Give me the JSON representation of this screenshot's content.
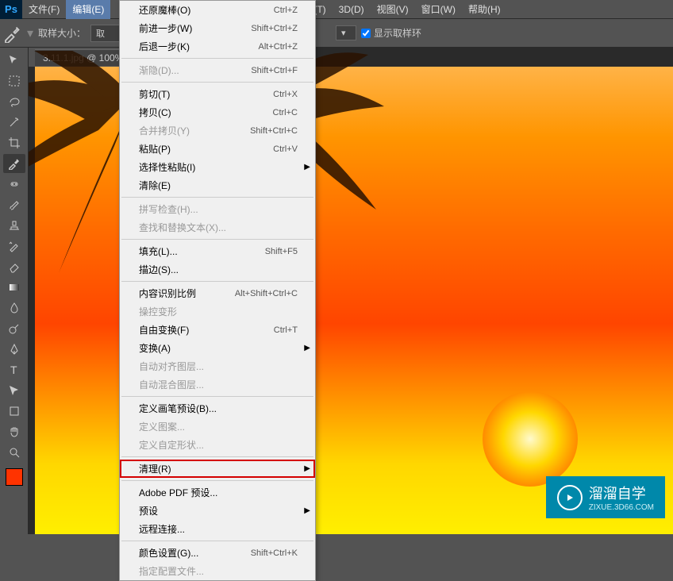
{
  "app": {
    "logo": "Ps"
  },
  "menubar": {
    "items": [
      "文件(F)",
      "编辑(E)",
      "",
      "",
      "(T)",
      "3D(D)",
      "视图(V)",
      "窗口(W)",
      "帮助(H)"
    ],
    "active_index": 1
  },
  "optionsbar": {
    "sample_size_label": "取样大小：",
    "sample_size_value": "取",
    "show_ring_label": "显示取样环"
  },
  "tab": {
    "title": "3.11.1.jpg @ 100%"
  },
  "dropdown": {
    "items": [
      {
        "label": "还原魔棒(O)",
        "shortcut": "Ctrl+Z"
      },
      {
        "label": "前进一步(W)",
        "shortcut": "Shift+Ctrl+Z"
      },
      {
        "label": "后退一步(K)",
        "shortcut": "Alt+Ctrl+Z"
      },
      {
        "sep": true
      },
      {
        "label": "渐隐(D)...",
        "shortcut": "Shift+Ctrl+F",
        "disabled": true
      },
      {
        "sep": true
      },
      {
        "label": "剪切(T)",
        "shortcut": "Ctrl+X"
      },
      {
        "label": "拷贝(C)",
        "shortcut": "Ctrl+C"
      },
      {
        "label": "合并拷贝(Y)",
        "shortcut": "Shift+Ctrl+C",
        "disabled": true
      },
      {
        "label": "粘贴(P)",
        "shortcut": "Ctrl+V"
      },
      {
        "label": "选择性粘贴(I)",
        "submenu": true
      },
      {
        "label": "清除(E)"
      },
      {
        "sep": true
      },
      {
        "label": "拼写检查(H)...",
        "disabled": true
      },
      {
        "label": "查找和替换文本(X)...",
        "disabled": true
      },
      {
        "sep": true
      },
      {
        "label": "填充(L)...",
        "shortcut": "Shift+F5"
      },
      {
        "label": "描边(S)..."
      },
      {
        "sep": true
      },
      {
        "label": "内容识别比例",
        "shortcut": "Alt+Shift+Ctrl+C"
      },
      {
        "label": "操控变形",
        "disabled": true
      },
      {
        "label": "自由变换(F)",
        "shortcut": "Ctrl+T"
      },
      {
        "label": "变换(A)",
        "submenu": true
      },
      {
        "label": "自动对齐图层...",
        "disabled": true
      },
      {
        "label": "自动混合图层...",
        "disabled": true
      },
      {
        "sep": true
      },
      {
        "label": "定义画笔预设(B)..."
      },
      {
        "label": "定义图案...",
        "disabled": true
      },
      {
        "label": "定义自定形状...",
        "disabled": true
      },
      {
        "sep": true
      },
      {
        "label": "清理(R)",
        "submenu": true,
        "highlight": true
      },
      {
        "sep": true
      },
      {
        "label": "Adobe PDF 预设..."
      },
      {
        "label": "预设",
        "submenu": true
      },
      {
        "label": "远程连接..."
      },
      {
        "sep": true
      },
      {
        "label": "颜色设置(G)...",
        "shortcut": "Shift+Ctrl+K"
      },
      {
        "label": "指定配置文件...",
        "disabled": true
      }
    ]
  },
  "colors": {
    "foreground": "#ff3300"
  },
  "watermark": {
    "main": "溜溜自学",
    "sub": "ZIXUE.3D66.COM"
  }
}
